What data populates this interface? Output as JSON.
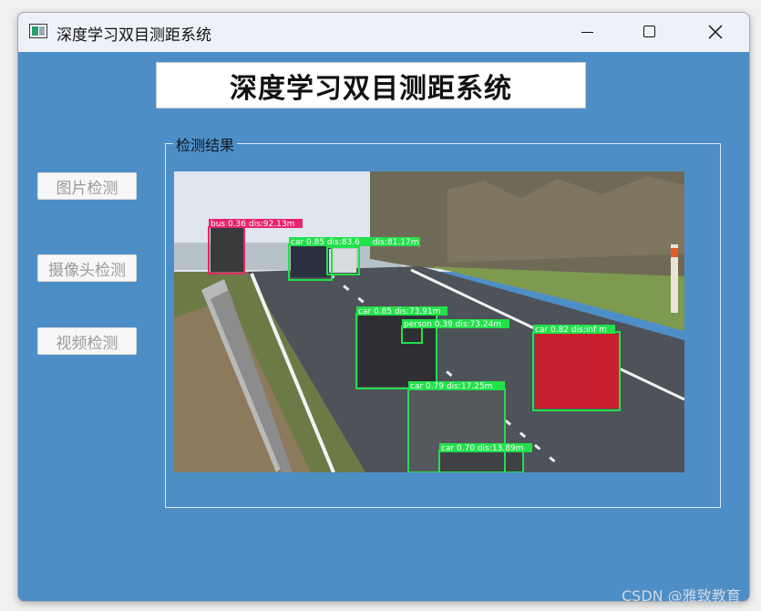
{
  "window": {
    "title": "深度学习双目测距系统",
    "controls": {
      "minimize_icon": "minimize-icon",
      "maximize_icon": "maximize-icon",
      "close_icon": "close-icon"
    }
  },
  "header": {
    "title": "深度学习双目测距系统"
  },
  "sidebar": {
    "buttons": [
      {
        "label": "图片检测"
      },
      {
        "label": "摄像头检测"
      },
      {
        "label": "视频检测"
      }
    ]
  },
  "result_group": {
    "title": "检测结果"
  },
  "detections": [
    {
      "label": "bus 0.36  dis:92.13m",
      "color": "#e8246c"
    },
    {
      "label": "car 0.85  dis:83.67m",
      "color": "#22e04a"
    },
    {
      "label": "dis:81.17m",
      "color": "#22e04a"
    },
    {
      "label": "car 0.85  dis:73.91m",
      "color": "#22e04a"
    },
    {
      "label": "person 0.39  dis:73.24m",
      "color": "#22e04a"
    },
    {
      "label": "car 0.82  dis:inf m",
      "color": "#22e04a"
    },
    {
      "label": "car 0.79  dis:17.25m",
      "color": "#22e04a"
    },
    {
      "label": "car 0.70  dis:13.89m",
      "color": "#22e04a"
    }
  ],
  "watermark": "CSDN @雅致教育"
}
